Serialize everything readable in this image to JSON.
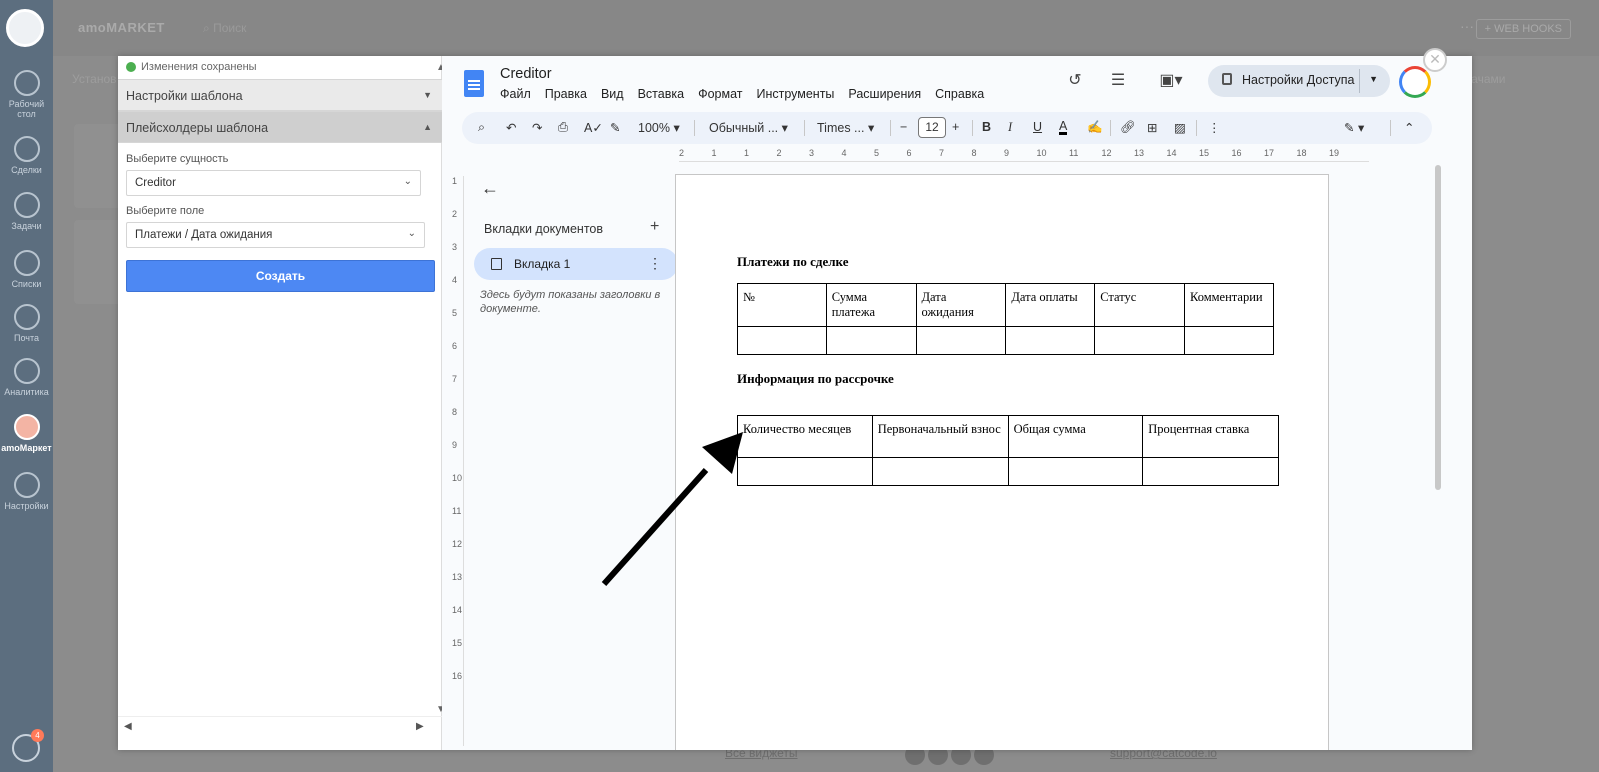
{
  "amo": {
    "title": "amoMARKET",
    "search_placeholder": "Поиск",
    "dots": "···",
    "webhooks": "+ WEB HOOKS",
    "tab_left": "Установ",
    "tab_right": "задачами",
    "nav": [
      {
        "label": "Рабочий стол",
        "icon": "dashboard-icon"
      },
      {
        "label": "Сделки",
        "icon": "deals-icon"
      },
      {
        "label": "Задачи",
        "icon": "tasks-icon"
      },
      {
        "label": "Списки",
        "icon": "lists-icon"
      },
      {
        "label": "Почта",
        "icon": "mail-icon"
      },
      {
        "label": "Аналитика",
        "icon": "analytics-icon"
      },
      {
        "label": "amoМаркет",
        "icon": "market-icon"
      },
      {
        "label": "Настройки",
        "icon": "settings-icon"
      }
    ],
    "chat_badge": "4",
    "footer_link_left": "Все виджеты",
    "footer_link_right": "support@catcode.io"
  },
  "left_panel": {
    "status": "Изменения сохранены",
    "accordion_settings": "Настройки шаблона",
    "accordion_placeholders": "Плейсхолдеры шаблона",
    "entity_label": "Выберите сущность",
    "entity_value": "Creditor",
    "field_label": "Выберите поле",
    "field_value": "Платежи / Дата ожидания",
    "create_button": "Создать"
  },
  "docs": {
    "title": "Creditor",
    "menu": [
      "Файл",
      "Правка",
      "Вид",
      "Вставка",
      "Формат",
      "Инструменты",
      "Расширения",
      "Справка"
    ],
    "share_label": "Настройки Доступа",
    "toolbar": {
      "zoom": "100%",
      "style": "Обычный ...",
      "font": "Times ...",
      "font_size": "12"
    },
    "outline": {
      "heading": "Вкладки документов",
      "tab_label": "Вкладка 1",
      "hint": "Здесь будут показаны заголовки в документе."
    },
    "ruler_h": [
      "2",
      "1",
      "1",
      "2",
      "3",
      "4",
      "5",
      "6",
      "7",
      "8",
      "9",
      "10",
      "11",
      "12",
      "13",
      "14",
      "15",
      "16",
      "17",
      "18",
      "19"
    ],
    "ruler_v": [
      "1",
      "2",
      "3",
      "4",
      "5",
      "6",
      "7",
      "8",
      "9",
      "10",
      "11",
      "12",
      "13",
      "14",
      "15",
      "16"
    ]
  },
  "document": {
    "section1_title": "Платежи по сделке",
    "table1_headers": [
      "№",
      "Сумма платежа",
      "Дата ожидания",
      "Дата оплаты",
      "Статус",
      "Комментарии"
    ],
    "section2_title": "Информация по рассрочке",
    "table2_headers": [
      "Количество месяцев",
      "Первоначальный взнос",
      "Общая сумма",
      "Процентная ставка"
    ]
  }
}
